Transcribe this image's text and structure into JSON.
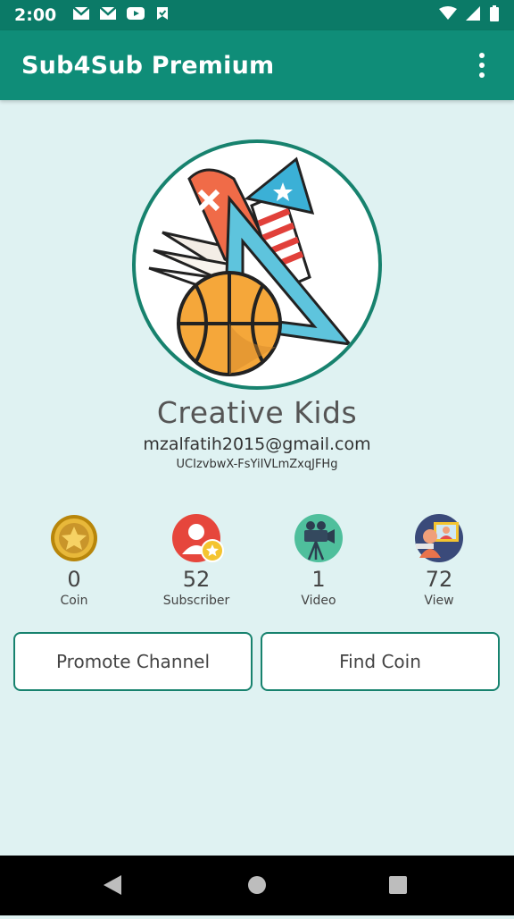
{
  "status_bar": {
    "time": "2:00",
    "left_icons": [
      "gmail-icon",
      "gmail-icon",
      "youtube-icon",
      "check-bookmark-icon"
    ],
    "right_icons": [
      "wifi-icon",
      "signal-icon",
      "battery-icon"
    ]
  },
  "app_bar": {
    "title": "Sub4Sub Premium",
    "menu_icon": "more-vert-icon"
  },
  "channel": {
    "name": "Creative Kids",
    "email": "mzalfatih2015@gmail.com",
    "id": "UCIzvbwX-FsYiIVLmZxqJFHg"
  },
  "stats": [
    {
      "icon": "coin-icon",
      "value": "0",
      "label": "Coin"
    },
    {
      "icon": "subscriber-icon",
      "value": "52",
      "label": "Subscriber"
    },
    {
      "icon": "video-camera-icon",
      "value": "1",
      "label": "Video"
    },
    {
      "icon": "viewer-icon",
      "value": "72",
      "label": "View"
    }
  ],
  "buttons": {
    "promote": "Promote Channel",
    "find_coin": "Find Coin"
  },
  "colors": {
    "primary": "#0f8d78",
    "primary_dark": "#0b7a67",
    "background": "#dff2f2",
    "accent_border": "#17826e"
  }
}
